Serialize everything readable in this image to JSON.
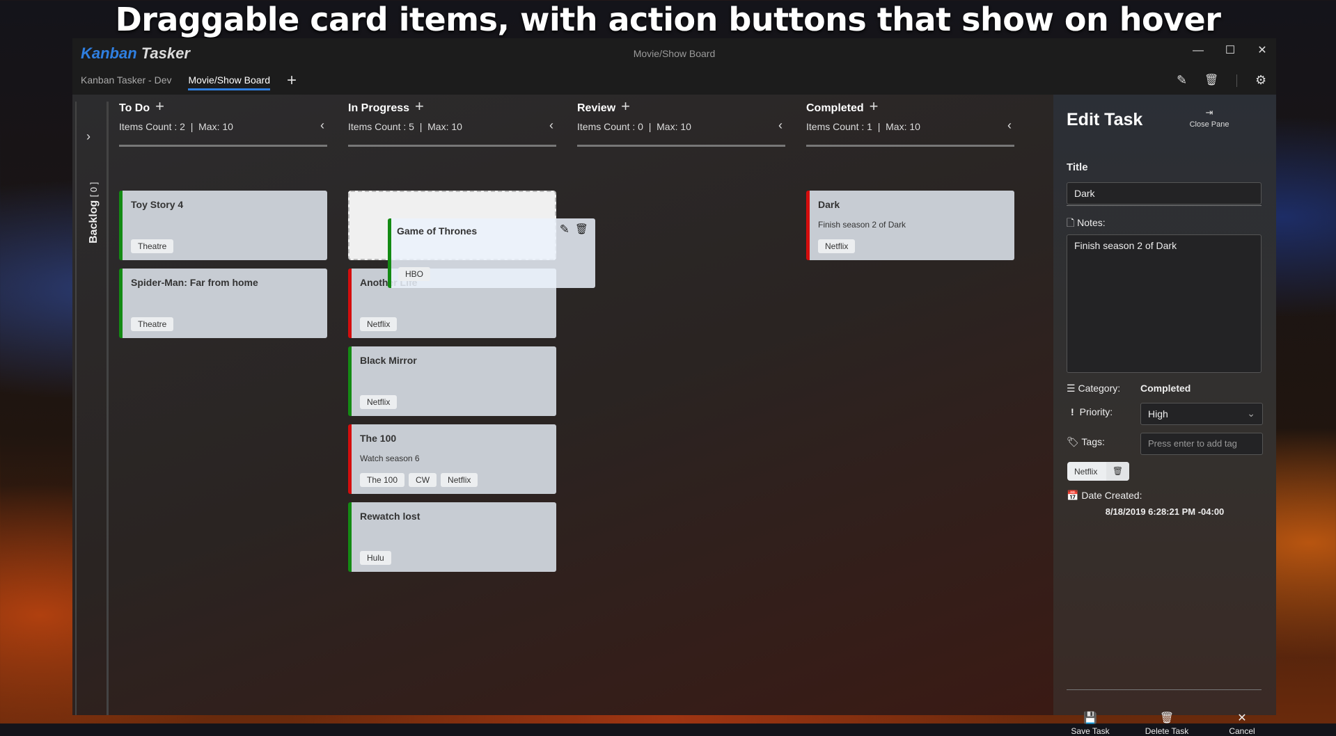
{
  "banner": "Draggable card items, with action buttons that show on hover",
  "app": {
    "logo_part1": "Kanban",
    "logo_part2": "Tasker",
    "window_title": "Movie/Show Board"
  },
  "tabs": [
    {
      "label": "Kanban Tasker - Dev",
      "active": false
    },
    {
      "label": "Movie/Show Board",
      "active": true
    }
  ],
  "icons": {
    "add": "+",
    "minimize": "—",
    "maximize": "☐",
    "close": "✕",
    "edit": "✎",
    "delete": "🗑",
    "settings": "⚙",
    "chevron_right": "›",
    "chevron_left": "‹"
  },
  "backlog": {
    "label": "Backlog",
    "count": "[ 0 ]"
  },
  "columns": [
    {
      "title": "To Do",
      "count_text": "Items Count : 2  |  Max: 10",
      "cards": [
        {
          "title": "Toy Story 4",
          "notes": "",
          "tags": [
            "Theatre"
          ],
          "priority_color": "#138a13"
        },
        {
          "title": "Spider-Man: Far from home",
          "notes": "",
          "tags": [
            "Theatre"
          ],
          "priority_color": "#138a13"
        }
      ]
    },
    {
      "title": "In Progress",
      "count_text": "Items Count : 5  |  Max: 10",
      "cards": [
        {
          "title": "Another Life",
          "notes": "",
          "tags": [
            "Netflix"
          ],
          "priority_color": "#d40d0d"
        },
        {
          "title": "Black Mirror",
          "notes": "",
          "tags": [
            "Netflix"
          ],
          "priority_color": "#138a13"
        },
        {
          "title": "The 100",
          "notes": "Watch season 6",
          "tags": [
            "The 100",
            "CW",
            "Netflix"
          ],
          "priority_color": "#d40d0d"
        },
        {
          "title": "Rewatch lost",
          "notes": "",
          "tags": [
            "Hulu"
          ],
          "priority_color": "#138a13"
        }
      ]
    },
    {
      "title": "Review",
      "count_text": "Items Count : 0  |  Max: 10",
      "cards": []
    },
    {
      "title": "Completed",
      "count_text": "Items Count : 1  |  Max: 10",
      "cards": [
        {
          "title": "Dark",
          "notes": "Finish season 2 of Dark",
          "tags": [
            "Netflix"
          ],
          "priority_color": "#d40d0d"
        }
      ]
    }
  ],
  "dragging_card": {
    "title": "Game of Thrones",
    "tags": [
      "HBO"
    ]
  },
  "edit_pane": {
    "heading": "Edit Task",
    "close_label": "Close Pane",
    "title_label": "Title",
    "title_value": "Dark",
    "notes_label": "Notes:",
    "notes_value": "Finish season 2 of Dark",
    "category_label": "Category:",
    "category_value": "Completed",
    "priority_label": "Priority:",
    "priority_value": "High",
    "tags_label": "Tags:",
    "tags_placeholder": "Press enter to add tag",
    "tags": [
      "Netflix"
    ],
    "date_label": "Date Created:",
    "date_value": "8/18/2019 6:28:21 PM -04:00",
    "save_label": "Save Task",
    "delete_label": "Delete Task",
    "cancel_label": "Cancel"
  }
}
